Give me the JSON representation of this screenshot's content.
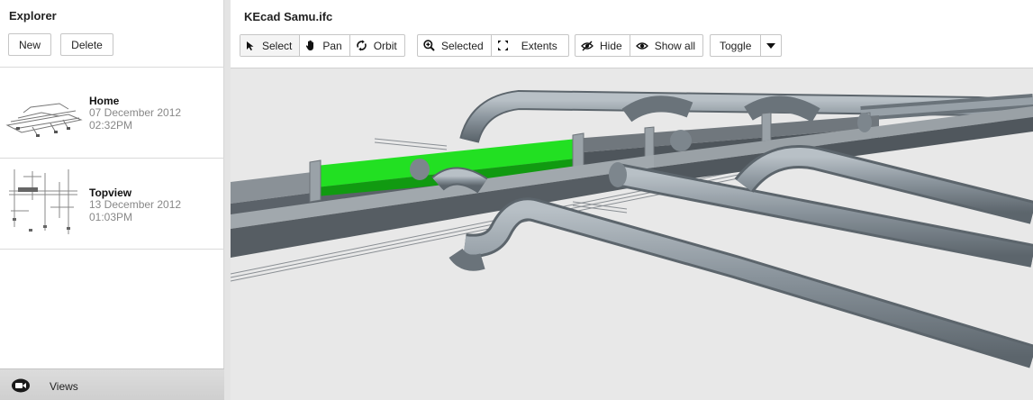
{
  "explorer": {
    "title": "Explorer",
    "new_label": "New",
    "delete_label": "Delete",
    "views": [
      {
        "name": "Home",
        "date": "07 December 2012",
        "time": "02:32PM"
      },
      {
        "name": "Topview",
        "date": "13 December 2012",
        "time": "01:03PM"
      }
    ],
    "footer_label": "Views"
  },
  "document": {
    "title": "KEcad Samu.ifc"
  },
  "toolbar": {
    "select_label": "Select",
    "pan_label": "Pan",
    "orbit_label": "Orbit",
    "selected_label": "Selected",
    "extents_label": "Extents",
    "hide_label": "Hide",
    "show_all_label": "Show all",
    "toggle_label": "Toggle"
  },
  "colors": {
    "selection": "#22e022",
    "duct": "#5b6269",
    "pipe": "#8a949c",
    "background": "#e8e8e8"
  }
}
